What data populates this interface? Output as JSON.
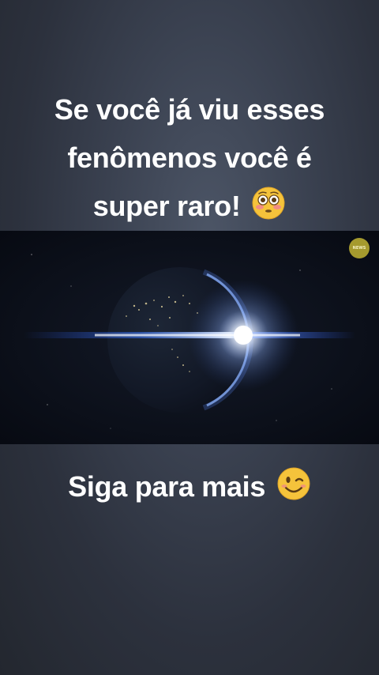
{
  "post": {
    "caption_top_line1": "Se você já viu esses",
    "caption_top_line2": "fenômenos você é",
    "caption_top_line3": "super raro!",
    "caption_top_emoji": "flushed-face-emoji",
    "caption_bottom": "Siga para mais",
    "caption_bottom_emoji": "winking-face-emoji"
  },
  "video": {
    "scene": "earth-sunrise-from-space",
    "watermark_text": "NEWS"
  },
  "colors": {
    "background": "#2c313d",
    "text": "#ffffff",
    "emoji_yellow": "#f5c33b",
    "sun_glow": "#bcd4ff",
    "watermark": "#a59a2e"
  }
}
